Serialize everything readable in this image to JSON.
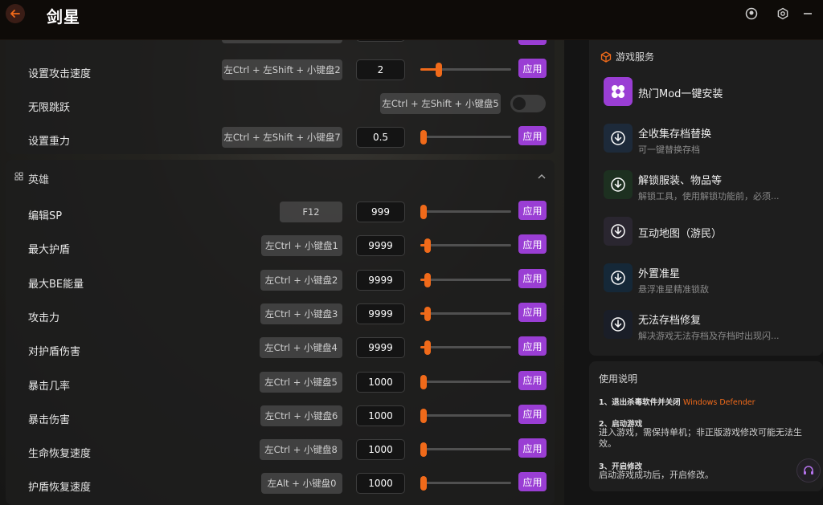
{
  "app": {
    "title": "剑星"
  },
  "top_card_rows": [
    {
      "label": "设置攻击速度",
      "hotkey": "左Ctrl + 左Shift + 小键盘2",
      "value": "2",
      "slider": 0.2
    },
    {
      "label": "无限跳跃",
      "hotkey": "左Ctrl + 左Shift + 小键盘5",
      "toggle": false
    },
    {
      "label": "设置重力",
      "hotkey": "左Ctrl + 左Shift + 小键盘7",
      "value": "0.5",
      "slider": 0.0
    }
  ],
  "hero_section": {
    "title": "英雄",
    "rows": [
      {
        "label": "编辑SP",
        "hotkey": "F12",
        "value": "999",
        "slider": 0.0
      },
      {
        "label": "最大护盾",
        "hotkey": "左Ctrl + 小键盘1",
        "value": "9999",
        "slider": 0.08
      },
      {
        "label": "最大BE能量",
        "hotkey": "左Ctrl + 小键盘2",
        "value": "9999",
        "slider": 0.08
      },
      {
        "label": "攻击力",
        "hotkey": "左Ctrl + 小键盘3",
        "value": "9999",
        "slider": 0.08
      },
      {
        "label": "对护盾伤害",
        "hotkey": "左Ctrl + 小键盘4",
        "value": "9999",
        "slider": 0.08
      },
      {
        "label": "暴击几率",
        "hotkey": "左Ctrl + 小键盘5",
        "value": "1000",
        "slider": 0.0
      },
      {
        "label": "暴击伤害",
        "hotkey": "左Ctrl + 小键盘6",
        "value": "1000",
        "slider": 0.0
      },
      {
        "label": "生命恢复速度",
        "hotkey": "左Ctrl + 小键盘8",
        "value": "1000",
        "slider": 0.0
      },
      {
        "label": "护盾恢复速度",
        "hotkey": "左Alt + 小键盘0",
        "value": "1000",
        "slider": 0.0
      }
    ]
  },
  "apply_label": "应用",
  "services": {
    "title": "游戏服务",
    "items": [
      {
        "title": "热门Mod一键安装",
        "subtitle": "",
        "icon": "mod-icon"
      },
      {
        "title": "全收集存档替换",
        "subtitle": "可一键替换存档",
        "icon": "download-icon"
      },
      {
        "title": "解锁服装、物品等",
        "subtitle": "解锁工具，使用解锁功能前，必须...",
        "icon": "download-icon"
      },
      {
        "title": "互动地图（游民）",
        "subtitle": "",
        "icon": "download-icon"
      },
      {
        "title": "外置准星",
        "subtitle": "悬浮准星精准锁敌",
        "icon": "download-icon"
      },
      {
        "title": "无法存档修复",
        "subtitle": "解决游戏无法存档及存档时出现闪...",
        "icon": "download-icon"
      }
    ]
  },
  "help": {
    "title": "使用说明",
    "step1_prefix": "1、退出杀毒软件并关闭",
    "step1_highlight": "Windows Defender",
    "step2_title": "2、启动游戏",
    "step2_text": "进入游戏，需保持单机；非正版游戏修改可能无法生效。",
    "step3_title": "3、开启修改",
    "step3_text": "启动游戏成功后，开启修改。"
  },
  "colors": {
    "accent": "#f06a1a",
    "apply": "#9a3ed4"
  }
}
